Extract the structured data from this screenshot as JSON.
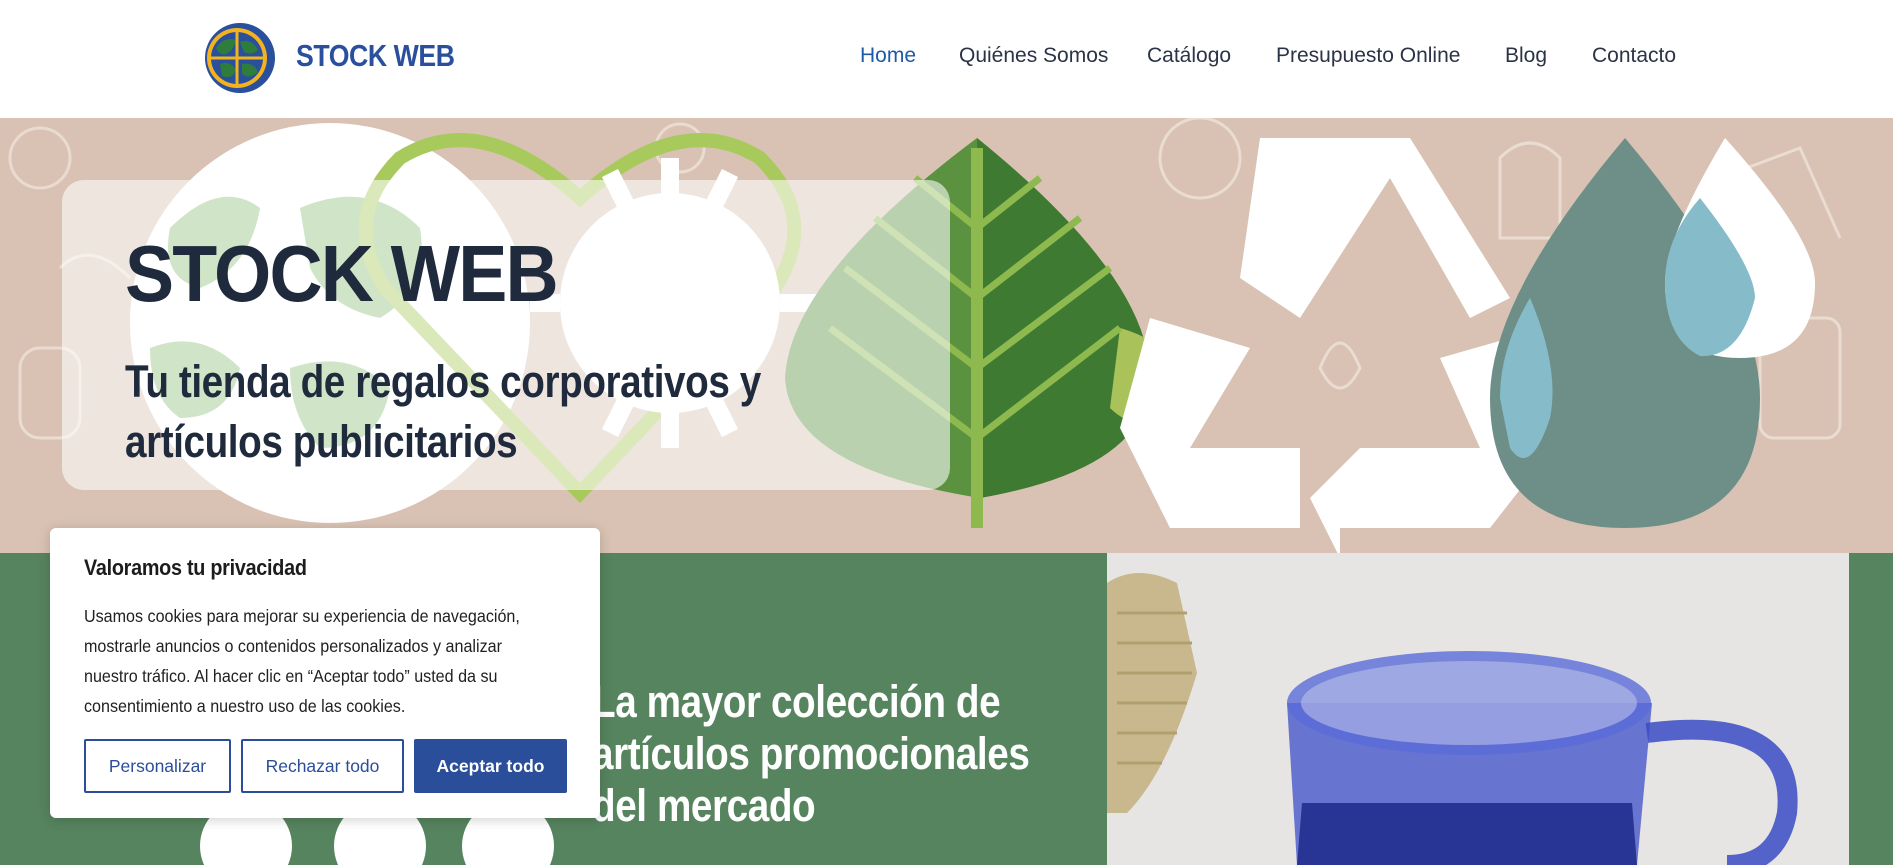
{
  "header": {
    "brand": "STOCK WEB",
    "nav": [
      {
        "label": "Home",
        "active": true
      },
      {
        "label": "Quiénes Somos",
        "active": false
      },
      {
        "label": "Catálogo",
        "active": false
      },
      {
        "label": "Presupuesto Online",
        "active": false
      },
      {
        "label": "Blog",
        "active": false
      },
      {
        "label": "Contacto",
        "active": false
      }
    ]
  },
  "hero": {
    "title": "STOCK WEB",
    "subtitle": "Tu tienda de regalos corporativos y artículos publicitarios"
  },
  "section": {
    "heading": "La mayor colección de artículos promocionales del mercado"
  },
  "cookie_banner": {
    "title": "Valoramos tu privacidad",
    "text": "Usamos cookies para mejorar su experiencia de navegación, mostrarle anuncios o contenidos personalizados y analizar nuestro tráfico. Al hacer clic en “Aceptar todo” usted da su consentimiento a nuestro uso de las cookies.",
    "customize_label": "Personalizar",
    "reject_label": "Rechazar todo",
    "accept_label": "Aceptar todo"
  },
  "colors": {
    "brand_blue": "#2a4f9c",
    "nav_active": "#1f5aa8",
    "hero_bg": "#d9c2b3",
    "section_green": "#56845e"
  }
}
